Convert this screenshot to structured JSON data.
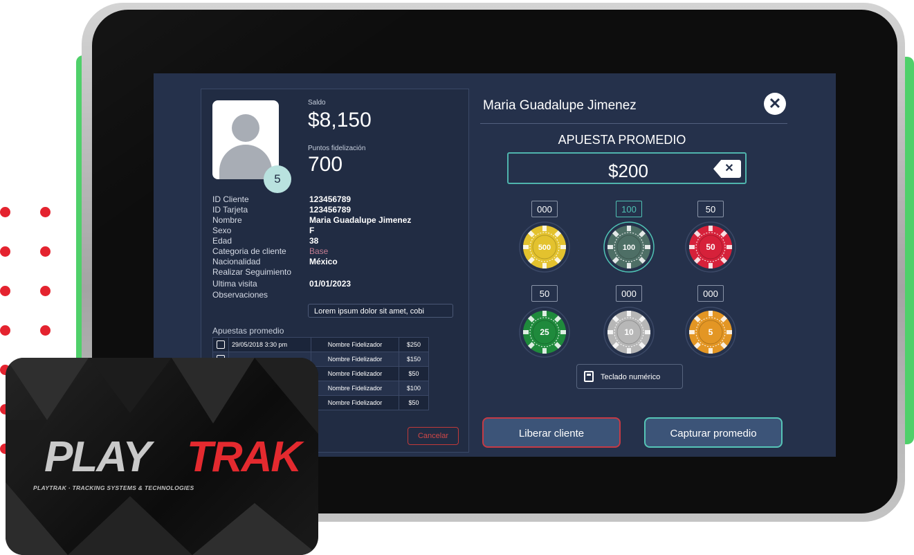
{
  "client": {
    "saldo_label": "Saldo",
    "saldo_value": "$8,150",
    "points_label": "Puntos fidelización",
    "points_value": "700",
    "level": "5",
    "fields": [
      {
        "label": "ID Cliente",
        "value": "123456789"
      },
      {
        "label": "ID Tarjeta",
        "value": "123456789"
      },
      {
        "label": "Nombre",
        "value": "Maria Guadalupe Jimenez"
      },
      {
        "label": "Sexo",
        "value": "F"
      },
      {
        "label": "Edad",
        "value": "38"
      },
      {
        "label": "Categoria de cliente",
        "value": "Base"
      },
      {
        "label": "Nacionalidad",
        "value": "México"
      },
      {
        "label": "Realizar Seguimiento",
        "value": ""
      },
      {
        "label": "Ultima visita",
        "value": "01/01/2023"
      },
      {
        "label": "Observaciones",
        "value": ""
      }
    ],
    "observaciones_value": "Lorem ipsum dolor sit amet, cobi",
    "bets_title": "Apuestas promedio",
    "bets": [
      {
        "date": "29/05/2018 3:30 pm",
        "name": "Nombre Fidelizador",
        "amount": "$250"
      },
      {
        "date": "",
        "name": "Nombre Fidelizador",
        "amount": "$150"
      },
      {
        "date": "",
        "name": "Nombre Fidelizador",
        "amount": "$50"
      },
      {
        "date": "",
        "name": "Nombre Fidelizador",
        "amount": "$100"
      },
      {
        "date": "",
        "name": "Nombre Fidelizador",
        "amount": "$50"
      }
    ],
    "cancel_label": "Cancelar"
  },
  "right": {
    "customer_name": "Maria Guadalupe Jimenez",
    "bet_title": "APUESTA PROMEDIO",
    "bet_amount": "$200",
    "chips": [
      {
        "count": "000",
        "denom": "500",
        "color": "#e3c22e",
        "active": false
      },
      {
        "count": "100",
        "denom": "100",
        "color": "#4e6f66",
        "active": true
      },
      {
        "count": "50",
        "denom": "50",
        "color": "#d6213a",
        "active": false
      },
      {
        "count": "50",
        "denom": "25",
        "color": "#1f8a3c",
        "active": false
      },
      {
        "count": "000",
        "denom": "10",
        "color": "#b7b7b7",
        "active": false
      },
      {
        "count": "000",
        "denom": "5",
        "color": "#e39624",
        "active": false
      }
    ],
    "keypad_label": "Teclado numérico",
    "release_label": "Liberar cliente",
    "capture_label": "Capturar promedio"
  },
  "card": {
    "logo_left": "PLAY",
    "logo_right": "TRAK",
    "tagline": "PLAYTRAK · TRACKING SYSTEMS & TECHNOLOGIES"
  },
  "colors": {
    "accent_teal": "#4fb4ad",
    "danger_red": "#c53a45",
    "brand_red": "#e42a2f",
    "screen_bg": "#25314b"
  }
}
